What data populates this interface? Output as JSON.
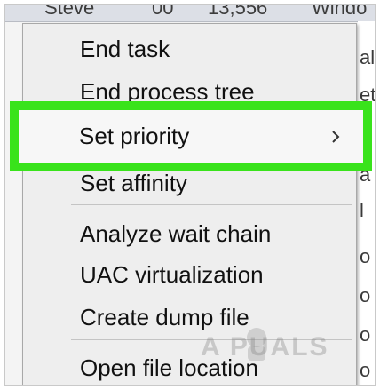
{
  "background": {
    "header_cells": [
      "Steve",
      "00",
      "13,556",
      "Windo"
    ],
    "right_fragments": [
      "all",
      "et",
      "a",
      "l",
      "o",
      "o",
      "o",
      "o",
      "o"
    ]
  },
  "context_menu": {
    "items": [
      {
        "label": "End task"
      },
      {
        "label": "End process tree"
      },
      {
        "label": "Set priority",
        "has_submenu": true,
        "highlighted": true
      },
      {
        "label": "Set affinity"
      },
      {
        "label": "Analyze wait chain"
      },
      {
        "label": "UAC virtualization"
      },
      {
        "label": "Create dump file"
      },
      {
        "label": "Open file location"
      }
    ]
  },
  "highlight_color": "#39e31b",
  "watermark": {
    "text": "A  PUALS"
  }
}
